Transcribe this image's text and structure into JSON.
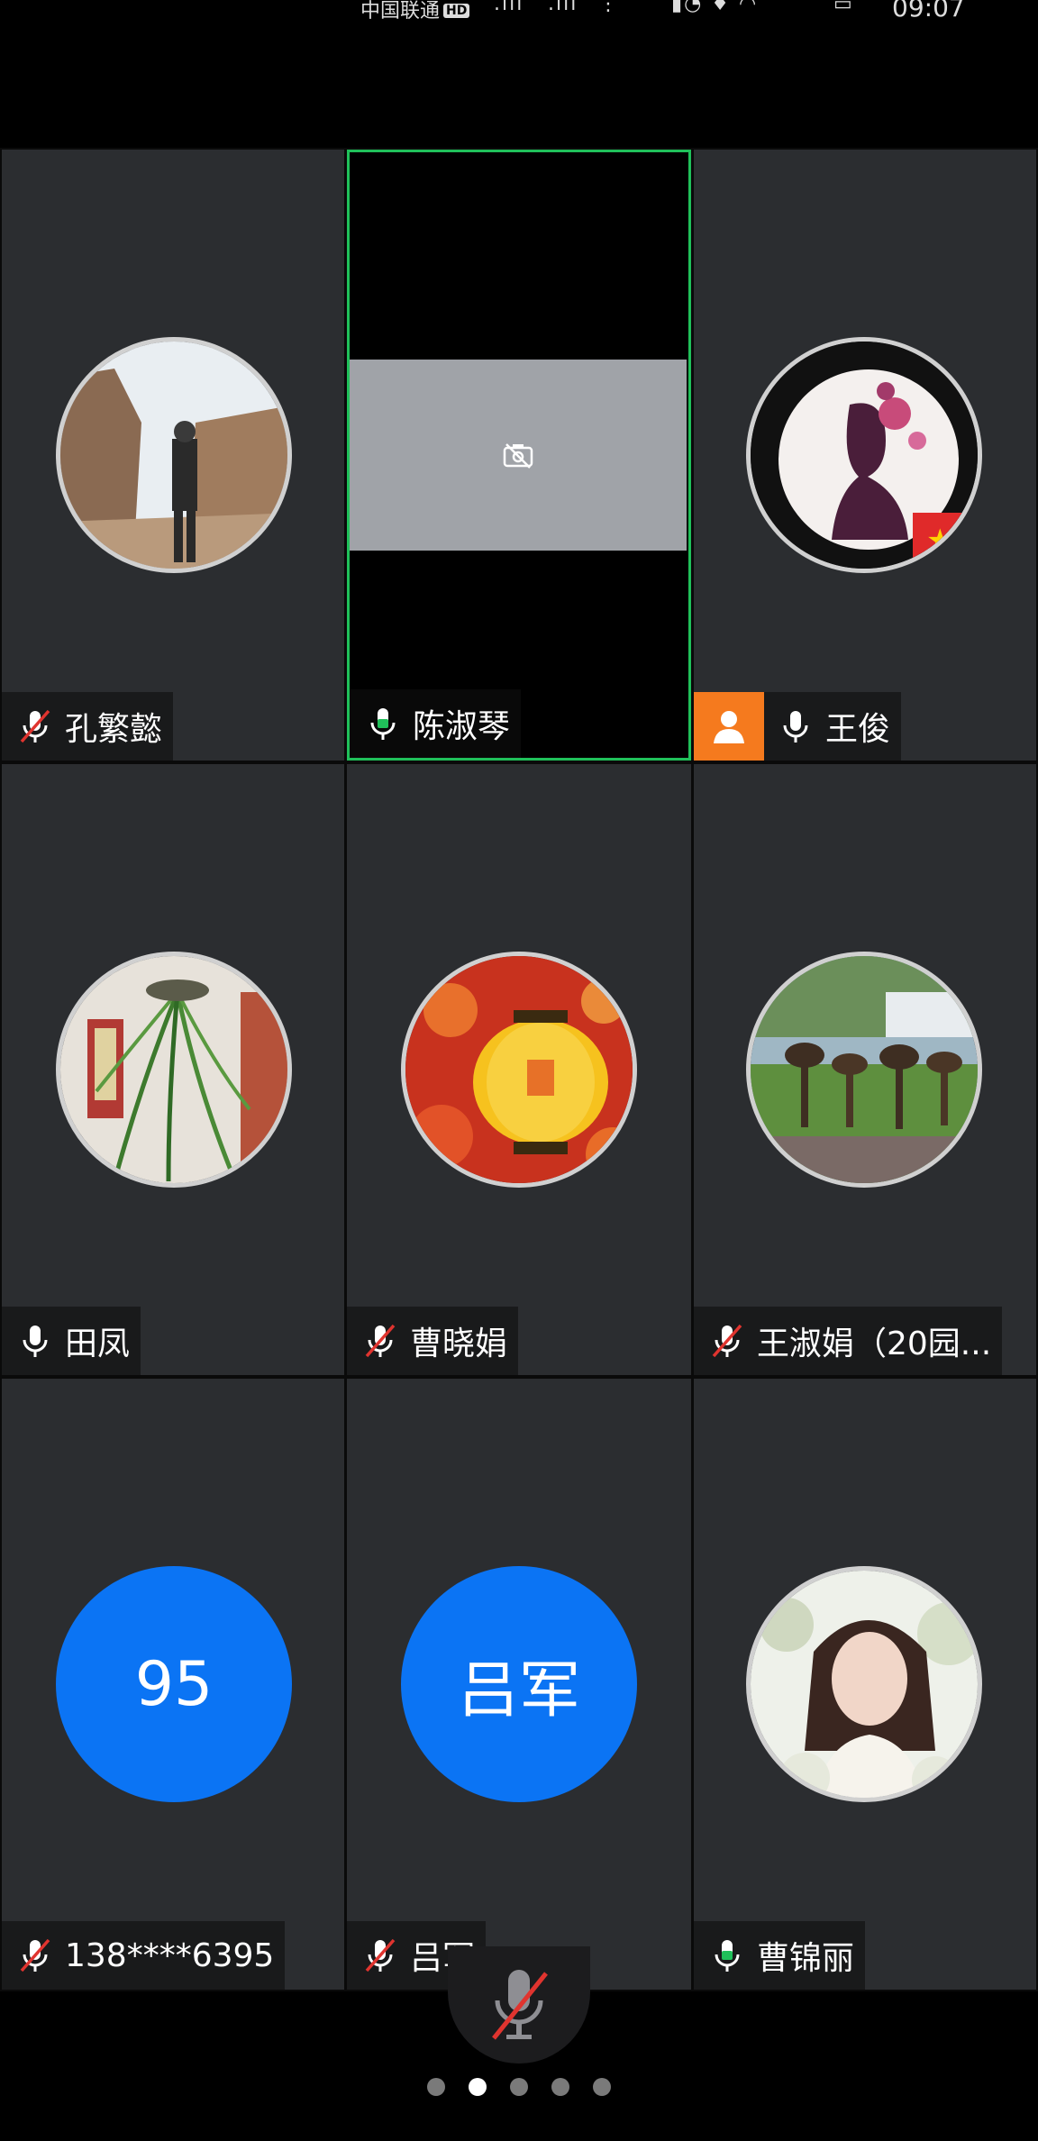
{
  "status_bar": {
    "carrier": "中国联通",
    "hd": "HD",
    "time": "09:07"
  },
  "participants": [
    {
      "name": "孔繁懿",
      "mic": "muted",
      "avatar": "photo-man-cliffs"
    },
    {
      "name": "陈淑琴",
      "mic": "on",
      "avatar": "camera-off",
      "active": true
    },
    {
      "name": "王俊",
      "mic": "on",
      "avatar": "photo-silhouette-flowers",
      "host": true
    },
    {
      "name": "田凤",
      "mic": "on-white",
      "avatar": "photo-plants"
    },
    {
      "name": "曹晓娟",
      "mic": "muted",
      "avatar": "photo-lantern"
    },
    {
      "name": "王淑娟（20园...",
      "mic": "muted",
      "avatar": "photo-sculptures"
    },
    {
      "name": "138****6395",
      "mic": "muted",
      "avatar_text": "95"
    },
    {
      "name": "吕军",
      "mic": "muted",
      "avatar_text": "吕军"
    },
    {
      "name": "曹锦丽",
      "mic": "on",
      "avatar": "photo-woman"
    }
  ],
  "pager": {
    "total": 5,
    "current": 2
  },
  "colors": {
    "tile_bg": "#2b2d30",
    "active_border": "#20c05a",
    "mic_on": "#20c05a",
    "mic_muted": "#e0342f",
    "host_badge": "#f57a1e",
    "text_avatar": "#0b74f4"
  }
}
